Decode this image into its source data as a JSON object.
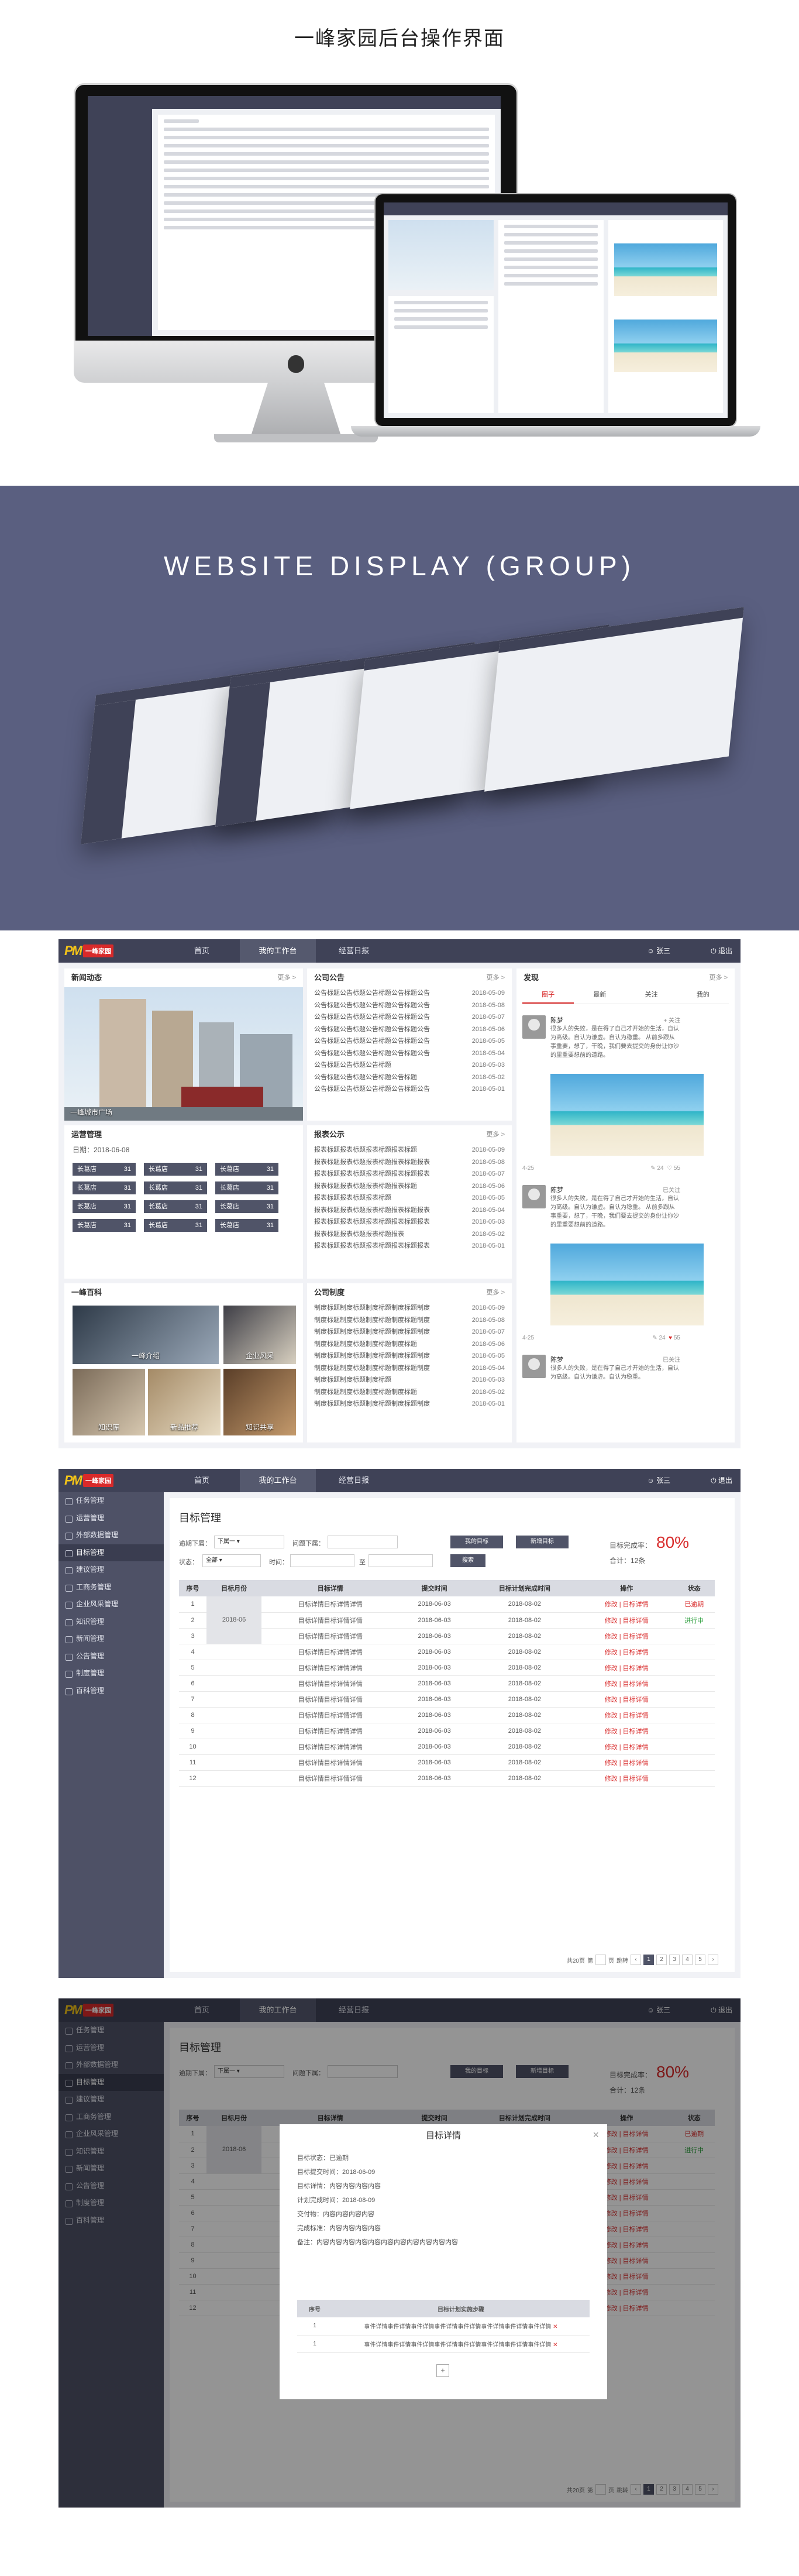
{
  "hero": {
    "title": "一峰家园后台操作界面"
  },
  "banner": {
    "title": "WEBSITE DISPLAY (GROUP)"
  },
  "brand": {
    "logo_text": "一峰家园"
  },
  "nav": {
    "items": [
      "首页",
      "我的工作台",
      "经营日报"
    ]
  },
  "user": {
    "name": "张三",
    "logout": "退出"
  },
  "news": {
    "title": "新闻动态",
    "more": "更多 >",
    "image_caption": "一峰城市广场"
  },
  "notice": {
    "title": "公司公告",
    "more": "更多 >",
    "items": [
      {
        "text": "公告标题公告标题公告标题公告标题公告",
        "date": "2018-05-09"
      },
      {
        "text": "公告标题公告标题公告标题公告标题公告",
        "date": "2018-05-08"
      },
      {
        "text": "公告标题公告标题公告标题公告标题公告",
        "date": "2018-05-07"
      },
      {
        "text": "公告标题公告标题公告标题公告标题公告",
        "date": "2018-05-06"
      },
      {
        "text": "公告标题公告标题公告标题公告标题公告",
        "date": "2018-05-05"
      },
      {
        "text": "公告标题公告标题公告标题公告标题公告",
        "date": "2018-05-04"
      },
      {
        "text": "公告标题公告标题公告标题",
        "date": "2018-05-03"
      },
      {
        "text": "公告标题公告标题公告标题公告标题",
        "date": "2018-05-02"
      },
      {
        "text": "公告标题公告标题公告标题公告标题公告",
        "date": "2018-05-01"
      }
    ]
  },
  "ops": {
    "title": "运营管理",
    "date": "日期：2018-06-08",
    "tags": [
      {
        "label": "长葛店",
        "count": "31"
      },
      {
        "label": "长葛店",
        "count": "31"
      },
      {
        "label": "长葛店",
        "count": "31"
      },
      {
        "label": "长葛店",
        "count": "31"
      },
      {
        "label": "长葛店",
        "count": "31"
      },
      {
        "label": "长葛店",
        "count": "31"
      },
      {
        "label": "长葛店",
        "count": "31"
      },
      {
        "label": "长葛店",
        "count": "31"
      },
      {
        "label": "长葛店",
        "count": "31"
      },
      {
        "label": "长葛店",
        "count": "31"
      },
      {
        "label": "长葛店",
        "count": "31"
      },
      {
        "label": "长葛店",
        "count": "31"
      }
    ]
  },
  "report": {
    "title": "报表公示",
    "more": "更多 >",
    "items": [
      {
        "text": "报表标题报表标题报表标题报表标题",
        "date": "2018-05-09"
      },
      {
        "text": "报表标题报表标题报表标题报表标题报表",
        "date": "2018-05-08"
      },
      {
        "text": "报表标题报表标题报表标题报表标题报表",
        "date": "2018-05-07"
      },
      {
        "text": "报表标题报表标题报表标题报表标题",
        "date": "2018-05-06"
      },
      {
        "text": "报表标题报表标题报表标题",
        "date": "2018-05-05"
      },
      {
        "text": "报表标题报表标题报表标题报表标题报表",
        "date": "2018-05-04"
      },
      {
        "text": "报表标题报表标题报表标题报表标题报表",
        "date": "2018-05-03"
      },
      {
        "text": "报表标题报表标题报表标题报表",
        "date": "2018-05-02"
      },
      {
        "text": "报表标题报表标题报表标题报表标题报表",
        "date": "2018-05-01"
      }
    ]
  },
  "baike": {
    "title": "一峰百科",
    "tiles": [
      "一峰介绍",
      "企业风采",
      "知识库",
      "新品推荐",
      "知识共享"
    ]
  },
  "rules": {
    "title": "公司制度",
    "more": "更多 >",
    "items": [
      {
        "text": "制度标题制度标题制度标题制度标题制度",
        "date": "2018-05-09"
      },
      {
        "text": "制度标题制度标题制度标题制度标题制度",
        "date": "2018-05-08"
      },
      {
        "text": "制度标题制度标题制度标题制度标题制度",
        "date": "2018-05-07"
      },
      {
        "text": "制度标题制度标题制度标题制度标题",
        "date": "2018-05-06"
      },
      {
        "text": "制度标题制度标题制度标题制度标题制度",
        "date": "2018-05-05"
      },
      {
        "text": "制度标题制度标题制度标题制度标题制度",
        "date": "2018-05-04"
      },
      {
        "text": "制度标题制度标题制度标题",
        "date": "2018-05-03"
      },
      {
        "text": "制度标题制度标题制度标题制度标题",
        "date": "2018-05-02"
      },
      {
        "text": "制度标题制度标题制度标题制度标题制度",
        "date": "2018-05-01"
      }
    ]
  },
  "feed": {
    "title": "发现",
    "more": "更多 >",
    "tabs": [
      "圈子",
      "最新",
      "关注",
      "我的"
    ],
    "posts": [
      {
        "name": "陈梦",
        "follow": "+ 关注",
        "text": "很多人的失败，是在得了自己才开始的生活，自认为高级。自认为谦虚。自认为稳重。 从前多跟从事重要，想了，干晚，我们要去提交的身份让你沙的里重要想前的道路。",
        "time": "4-25",
        "comments": "24",
        "likes": "55"
      },
      {
        "name": "陈梦",
        "follow": "已关注",
        "text": "很多人的失败，是在得了自己才开始的生活，自认为高级。自认为谦虚。自认为稳重。 从前多跟从事重要，想了，干晚，我们要去提交的身份让你沙的里重要想前的道路。",
        "time": "4-25",
        "comments": "24",
        "likes": "55"
      },
      {
        "name": "陈梦",
        "follow": "已关注",
        "text": "很多人的失败，是在得了自己才开始的生活，自认为高级。自认为谦虚。自认为稳重。",
        "time": "",
        "comments": "",
        "likes": ""
      }
    ]
  },
  "sidebar": {
    "items": [
      "任务管理",
      "运营管理",
      "外部数据管理",
      "目标管理",
      "建议管理",
      "工商务管理",
      "企业风采管理",
      "知识管理",
      "新闻管理",
      "公告管理",
      "制度管理",
      "百科管理"
    ],
    "active": 3
  },
  "goals": {
    "title": "目标管理",
    "filter": {
      "due_label": "逾期下属：",
      "due_value": "下属一",
      "issue_label": "问题下属：",
      "status_label": "状态：",
      "status_value": "全部",
      "time_label": "时间：",
      "to": "至",
      "my_btn": "我的目标",
      "new_btn": "新增目标",
      "search_btn": "搜索"
    },
    "rate_label": "目标完成率：",
    "rate": "80%",
    "total": "合计：12条",
    "headers": [
      "序号",
      "目标月份",
      "目标详情",
      "提交时间",
      "目标计划完成时间",
      "操作",
      "状态"
    ],
    "month": "2018-06",
    "rows": [
      {
        "no": "1",
        "detail": "目标详情目标详情详情",
        "submit": "2018-06-03",
        "plan": "2018-08-02",
        "op": "修改 | 目标详情",
        "status": "已逾期",
        "st": "red"
      },
      {
        "no": "2",
        "detail": "目标详情目标详情详情",
        "submit": "2018-06-03",
        "plan": "2018-08-02",
        "op": "修改 | 目标详情",
        "status": "进行中",
        "st": "grn"
      },
      {
        "no": "3",
        "detail": "目标详情目标详情详情",
        "submit": "2018-06-03",
        "plan": "2018-08-02",
        "op": "修改 | 目标详情",
        "status": "",
        "st": ""
      },
      {
        "no": "4",
        "detail": "目标详情目标详情详情",
        "submit": "2018-06-03",
        "plan": "2018-08-02",
        "op": "修改 | 目标详情",
        "status": "",
        "st": ""
      },
      {
        "no": "5",
        "detail": "目标详情目标详情详情",
        "submit": "2018-06-03",
        "plan": "2018-08-02",
        "op": "修改 | 目标详情",
        "status": "",
        "st": ""
      },
      {
        "no": "6",
        "detail": "目标详情目标详情详情",
        "submit": "2018-06-03",
        "plan": "2018-08-02",
        "op": "修改 | 目标详情",
        "status": "",
        "st": ""
      },
      {
        "no": "7",
        "detail": "目标详情目标详情详情",
        "submit": "2018-06-03",
        "plan": "2018-08-02",
        "op": "修改 | 目标详情",
        "status": "",
        "st": ""
      },
      {
        "no": "8",
        "detail": "目标详情目标详情详情",
        "submit": "2018-06-03",
        "plan": "2018-08-02",
        "op": "修改 | 目标详情",
        "status": "",
        "st": ""
      },
      {
        "no": "9",
        "detail": "目标详情目标详情详情",
        "submit": "2018-06-03",
        "plan": "2018-08-02",
        "op": "修改 | 目标详情",
        "status": "",
        "st": ""
      },
      {
        "no": "10",
        "detail": "目标详情目标详情详情",
        "submit": "2018-06-03",
        "plan": "2018-08-02",
        "op": "修改 | 目标详情",
        "status": "",
        "st": ""
      },
      {
        "no": "11",
        "detail": "目标详情目标详情详情",
        "submit": "2018-06-03",
        "plan": "2018-08-02",
        "op": "修改 | 目标详情",
        "status": "",
        "st": ""
      },
      {
        "no": "12",
        "detail": "目标详情目标详情详情",
        "submit": "2018-06-03",
        "plan": "2018-08-02",
        "op": "修改 | 目标详情",
        "status": "",
        "st": ""
      }
    ],
    "pager": {
      "total": "共20页",
      "jump": "第",
      "page": "页",
      "go": "跳转",
      "pages": [
        "1",
        "2",
        "3",
        "4",
        "5"
      ]
    }
  },
  "modal": {
    "title": "目标详情",
    "close": "×",
    "lines": [
      "目标状态：已逾期",
      "目标提交时间：2018-06-09",
      "目标详情：内容内容内容内容",
      "计划完成时间：2018-08-09",
      "交付物：内容内容内容内容",
      "完成标准：内容内容内容内容",
      "备注：内容内容内容内容内容内容内容内容内容内容内容"
    ],
    "headers": [
      "序号",
      "目标计划实施步骤"
    ],
    "rows": [
      {
        "no": "1",
        "text": "事件详情事件详情事件详情事件详情事件详情事件详情事件详情事件详情"
      },
      {
        "no": "1",
        "text": "事件详情事件详情事件详情事件详情事件详情事件详情事件详情事件详情"
      }
    ],
    "add": "+"
  }
}
